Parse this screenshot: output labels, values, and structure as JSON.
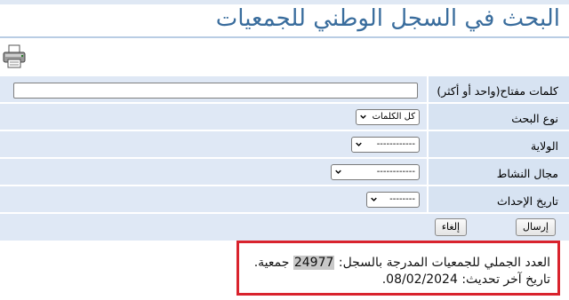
{
  "page": {
    "title": "البحث في السجل الوطني للجمعيات"
  },
  "icons": {
    "print": "printer-icon"
  },
  "form": {
    "keywords_label": "كلمات مفتاح(واحد أو أكثر)",
    "keywords_value": "",
    "search_type_label": "نوع البحث",
    "search_type_value": "كل الكلمات",
    "wilaya_label": "الولاية",
    "wilaya_value": "------------",
    "activity_label": "مجال النشاط",
    "activity_value": "------------",
    "date_label": "تاريخ الإحداث",
    "date_value": "--------",
    "submit_label": "إرسال",
    "cancel_label": "إلغاء"
  },
  "result": {
    "count_prefix": "العدد الجملي للجمعيات المدرجة بالسجل:",
    "count_value": "24977",
    "count_suffix": "جمعية.",
    "update_prefix": "تاريخ آخر تحديث:",
    "update_value": "08/02/2024."
  },
  "colors": {
    "title": "#3a6d9d",
    "label_bg": "#d7e3f2",
    "row_bg": "#dfe8f5",
    "highlight_border": "#d9232d"
  }
}
